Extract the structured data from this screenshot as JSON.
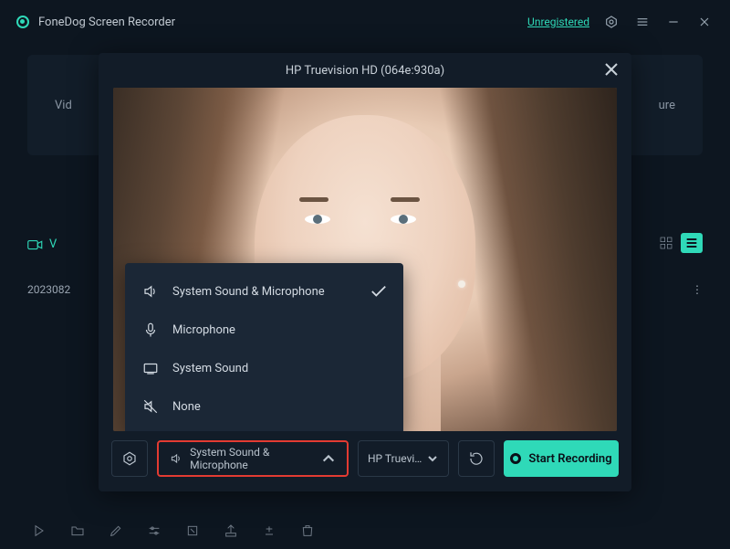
{
  "titlebar": {
    "app_name": "FoneDog Screen Recorder",
    "unregistered": "Unregistered"
  },
  "background": {
    "left_tab": "Vid",
    "right_tab": "ure",
    "video_tab": "V",
    "file_date": "2023082"
  },
  "dialog": {
    "header": "HP Truevision HD (064e:930a)",
    "audio_options": [
      {
        "label": "System Sound & Microphone",
        "selected": true
      },
      {
        "label": "Microphone",
        "selected": false
      },
      {
        "label": "System Sound",
        "selected": false
      },
      {
        "label": "None",
        "selected": false
      }
    ],
    "audio_selected": "System Sound & Microphone",
    "camera_selected": "HP Truevi…",
    "start_button": "Start Recording"
  }
}
